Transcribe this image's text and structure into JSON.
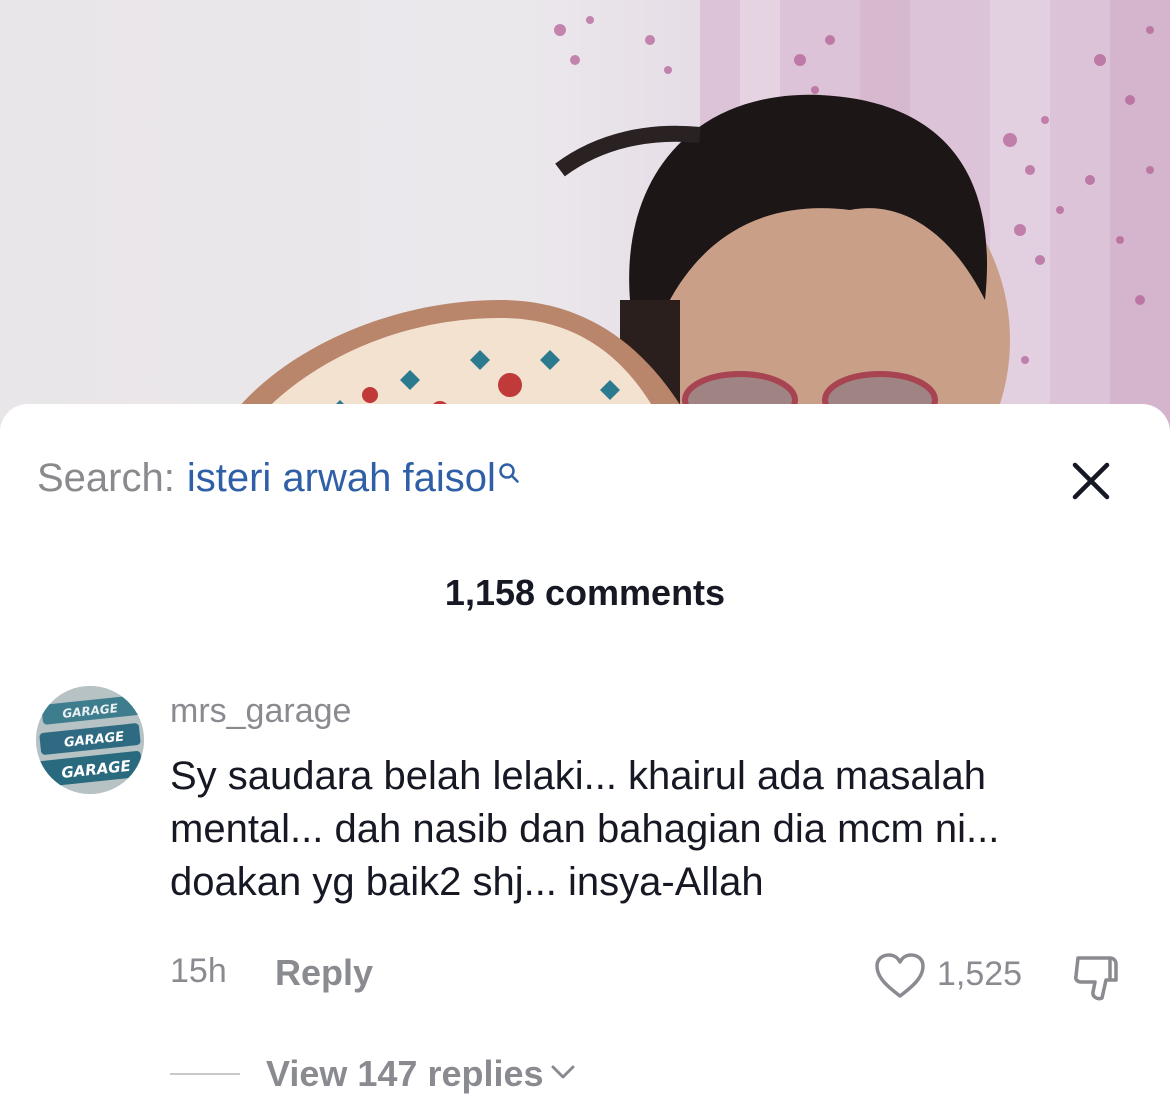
{
  "search": {
    "prefix": "Search:",
    "query": "isteri arwah faisol"
  },
  "comments_header": {
    "count_label": "1,158 comments"
  },
  "comment": {
    "username": "mrs_garage",
    "avatar_text": "GARAGE",
    "text": "Sy saudara belah lelaki... khairul ada masalah mental... dah nasib dan bahagian dia mcm ni... doakan yg baik2 shj... insya-Allah",
    "time": "15h",
    "reply_label": "Reply",
    "likes": "1,525",
    "view_replies_label": "View 147 replies"
  },
  "icons": {
    "search": "search-icon",
    "close": "close-icon",
    "like": "heart-icon",
    "dislike": "thumbs-down-icon",
    "expand": "chevron-down-icon"
  },
  "colors": {
    "search_query": "#2f5fa6",
    "text_primary": "#161823",
    "text_secondary": "#8a8b91"
  }
}
